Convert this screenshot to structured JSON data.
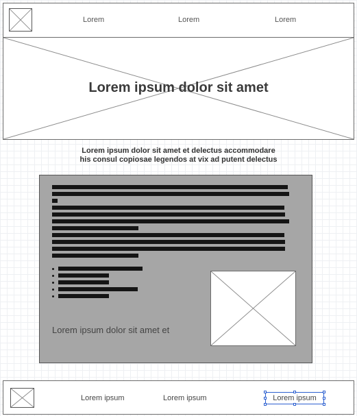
{
  "nav": {
    "links": [
      "Lorem",
      "Lorem",
      "Lorem"
    ]
  },
  "hero": {
    "title": "Lorem ipsum dolor sit amet"
  },
  "intro": {
    "line1": "Lorem ipsum dolor sit amet et delectus accommodare",
    "line2": "his consul copiosae legendos at vix ad putent delectus"
  },
  "panel": {
    "caption": "Lorem ipsum dolor sit amet et",
    "text_bar_count": 11,
    "bullet_count": 5
  },
  "footer": {
    "links": [
      "Lorem ipsum",
      "Lorem ipsum"
    ],
    "selected_link": "Lorem ipsum"
  },
  "colors": {
    "panel_background": "#a6a6a6",
    "text_bar": "#151515",
    "selection": "#2b5fd0"
  }
}
